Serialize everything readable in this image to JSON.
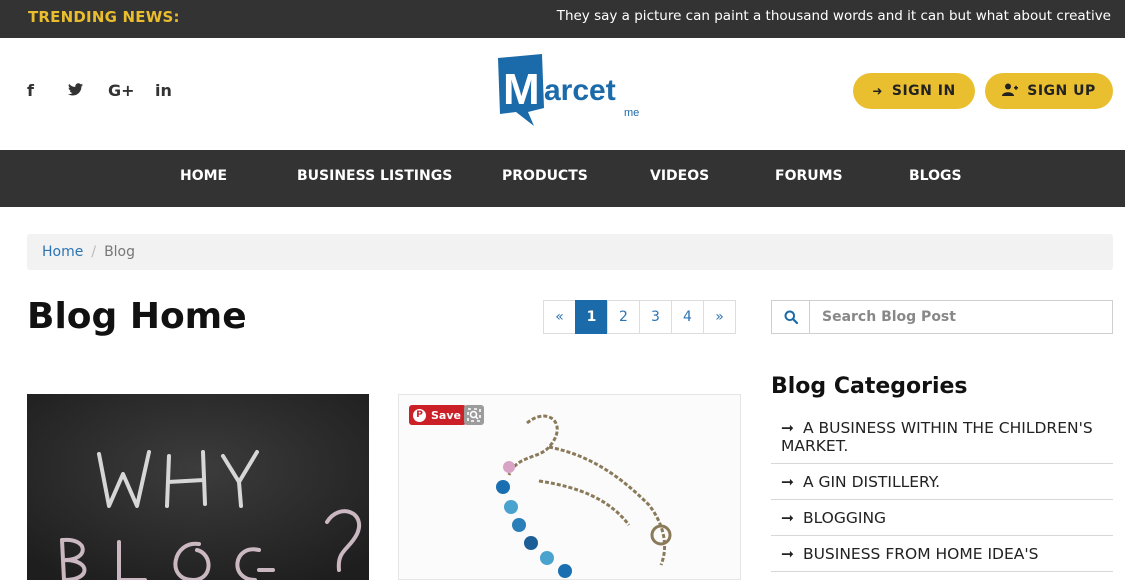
{
  "trending": {
    "label": "TRENDING NEWS:",
    "text": "They say a picture can paint a thousand words and it can but what about creative"
  },
  "social": [
    {
      "icon": "facebook-icon",
      "glyph": "f"
    },
    {
      "icon": "twitter-icon",
      "glyph": "t"
    },
    {
      "icon": "google-plus-icon",
      "glyph": "G+"
    },
    {
      "icon": "linkedin-icon",
      "glyph": "in"
    }
  ],
  "logo": {
    "text": "Marcet",
    "sub": "me"
  },
  "auth": {
    "sign_in": "SIGN IN",
    "sign_up": "SIGN UP"
  },
  "nav": {
    "items": [
      "HOME",
      "BUSINESS LISTINGS",
      "PRODUCTS",
      "VIDEOS",
      "FORUMS",
      "BLOGS"
    ]
  },
  "breadcrumb": {
    "home": "Home",
    "separator": "/",
    "current": "Blog"
  },
  "page": {
    "title": "Blog Home"
  },
  "pagination": {
    "prev": "«",
    "pages": [
      "1",
      "2",
      "3",
      "4"
    ],
    "next": "»",
    "active": "1"
  },
  "search": {
    "placeholder": "Search Blog Post"
  },
  "cards": {
    "card2": {
      "save_label": "Save"
    }
  },
  "categories": {
    "title": "Blog Categories",
    "arrow": "➞",
    "items": [
      "A BUSINESS WITHIN THE CHILDREN'S MARKET.",
      "A GIN DISTILLERY.",
      "BLOGGING",
      "BUSINESS FROM HOME IDEA'S"
    ]
  },
  "colors": {
    "bar": "#333333",
    "accent": "#eabf2f",
    "link": "#2c74b3",
    "active_page": "#1b6aa9",
    "pinterest": "#cb2027"
  }
}
